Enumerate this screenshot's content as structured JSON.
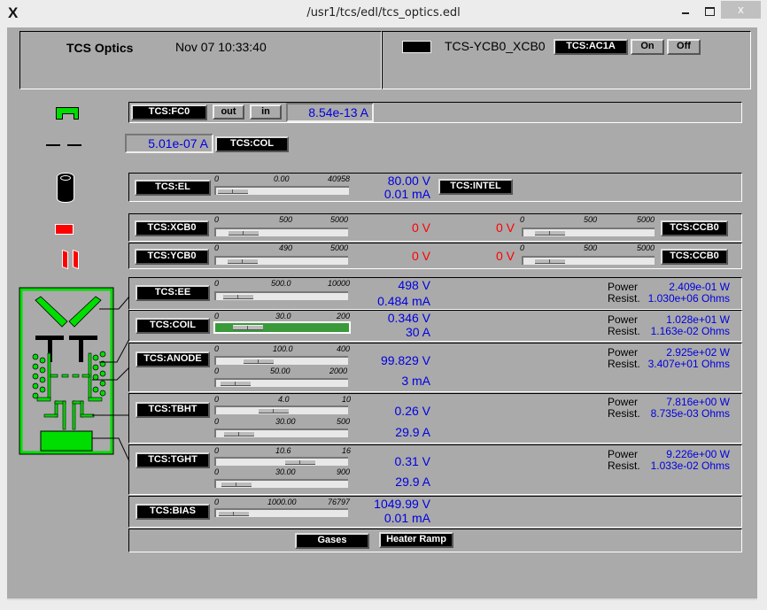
{
  "window": {
    "title": "/usr1/tcs/edl/tcs_optics.edl",
    "logo": "X",
    "close_label": "x"
  },
  "header": {
    "title": "TCS Optics",
    "datetime": "Nov 07 10:33:40",
    "ycb_label": "TCS-YCB0_XCB0",
    "ac1a_label": "TCS:AC1A",
    "on_label": "On",
    "off_label": "Off"
  },
  "fc0": {
    "label": "TCS:FC0",
    "out_label": "out",
    "in_label": "in",
    "current": "8.54e-13 A"
  },
  "col": {
    "label": "TCS:COL",
    "current": "5.01e-07 A"
  },
  "el": {
    "label": "TCS:EL",
    "intel_label": "TCS:INTEL",
    "scale_min": "0",
    "scale_mid": "0.00",
    "scale_max": "40958",
    "setpoint_fraction": 0.0,
    "voltage": "80.00 V",
    "current": "0.01 mA"
  },
  "xcb0": {
    "label": "TCS:XCB0",
    "scale_min": "0",
    "scale_mid": "500",
    "scale_max": "5000",
    "setpoint_fraction": 0.1,
    "voltage": "0 V"
  },
  "ycb0": {
    "label": "TCS:YCB0",
    "scale_min": "0",
    "scale_mid": "490",
    "scale_max": "5000",
    "setpoint_fraction": 0.098,
    "voltage": "0 V"
  },
  "ccb0_x": {
    "label": "TCS:CCB0",
    "scale_min": "0",
    "scale_mid": "500",
    "scale_max": "5000",
    "setpoint_fraction": 0.1,
    "voltage": "0 V"
  },
  "ccb0_y": {
    "label": "TCS:CCB0",
    "scale_min": "0",
    "scale_mid": "500",
    "scale_max": "5000",
    "setpoint_fraction": 0.1,
    "voltage": "0 V"
  },
  "ee": {
    "label": "TCS:EE",
    "scale_min": "0",
    "scale_mid": "500.0",
    "scale_max": "10000",
    "setpoint_fraction": 0.05,
    "voltage": "498 V",
    "current": "0.484 mA",
    "power_label": "Power",
    "power": "2.409e-01 W",
    "resist_label": "Resist.",
    "resist": "1.030e+06 Ohms"
  },
  "coil": {
    "label": "TCS:COIL",
    "scale_min": "0",
    "scale_mid": "30.0",
    "scale_max": "200",
    "setpoint_fraction": 0.15,
    "voltage": "0.346 V",
    "current": "30 A",
    "power_label": "Power",
    "power": "1.028e+01 W",
    "resist_label": "Resist.",
    "resist": "1.163e-02 Ohms"
  },
  "anode": {
    "label": "TCS:ANODE",
    "v_scale_min": "0",
    "v_scale_mid": "100.0",
    "v_scale_max": "400",
    "v_setpoint_fraction": 0.25,
    "i_scale_min": "0",
    "i_scale_mid": "50.00",
    "i_scale_max": "2000",
    "i_setpoint_fraction": 0.025,
    "voltage": "99.829 V",
    "current": "3 mA",
    "power_label": "Power",
    "power": "2.925e+02 W",
    "resist_label": "Resist.",
    "resist": "3.407e+01 Ohms"
  },
  "tbht": {
    "label": "TCS:TBHT",
    "v_scale_min": "0",
    "v_scale_mid": "4.0",
    "v_scale_max": "10",
    "v_setpoint_fraction": 0.4,
    "i_scale_min": "0",
    "i_scale_mid": "30.00",
    "i_scale_max": "500",
    "i_setpoint_fraction": 0.06,
    "voltage": "0.26 V",
    "current": "29.9 A",
    "power_label": "Power",
    "power": "7.816e+00 W",
    "resist_label": "Resist.",
    "resist": "8.735e-03 Ohms"
  },
  "tght": {
    "label": "TCS:TGHT",
    "v_scale_min": "0",
    "v_scale_mid": "10.6",
    "v_scale_max": "16",
    "v_setpoint_fraction": 0.6625,
    "i_scale_min": "0",
    "i_scale_mid": "30.00",
    "i_scale_max": "900",
    "i_setpoint_fraction": 0.033,
    "voltage": "0.31 V",
    "current": "29.9 A",
    "power_label": "Power",
    "power": "9.226e+00 W",
    "resist_label": "Resist.",
    "resist": "1.033e-02 Ohms"
  },
  "bias": {
    "label": "TCS:BIAS",
    "scale_min": "0",
    "scale_mid": "1000.00",
    "scale_max": "76797",
    "setpoint_fraction": 0.013,
    "voltage": "1049.99 V",
    "current": "0.01 mA"
  },
  "footer": {
    "gases_label": "Gases",
    "heater_label": "Heater Ramp"
  },
  "colors": {
    "accent_green": "#00dd00",
    "readout_blue": "#0000e0",
    "alarm_red": "#ff0000",
    "panel_gray": "#aaaaaa"
  }
}
